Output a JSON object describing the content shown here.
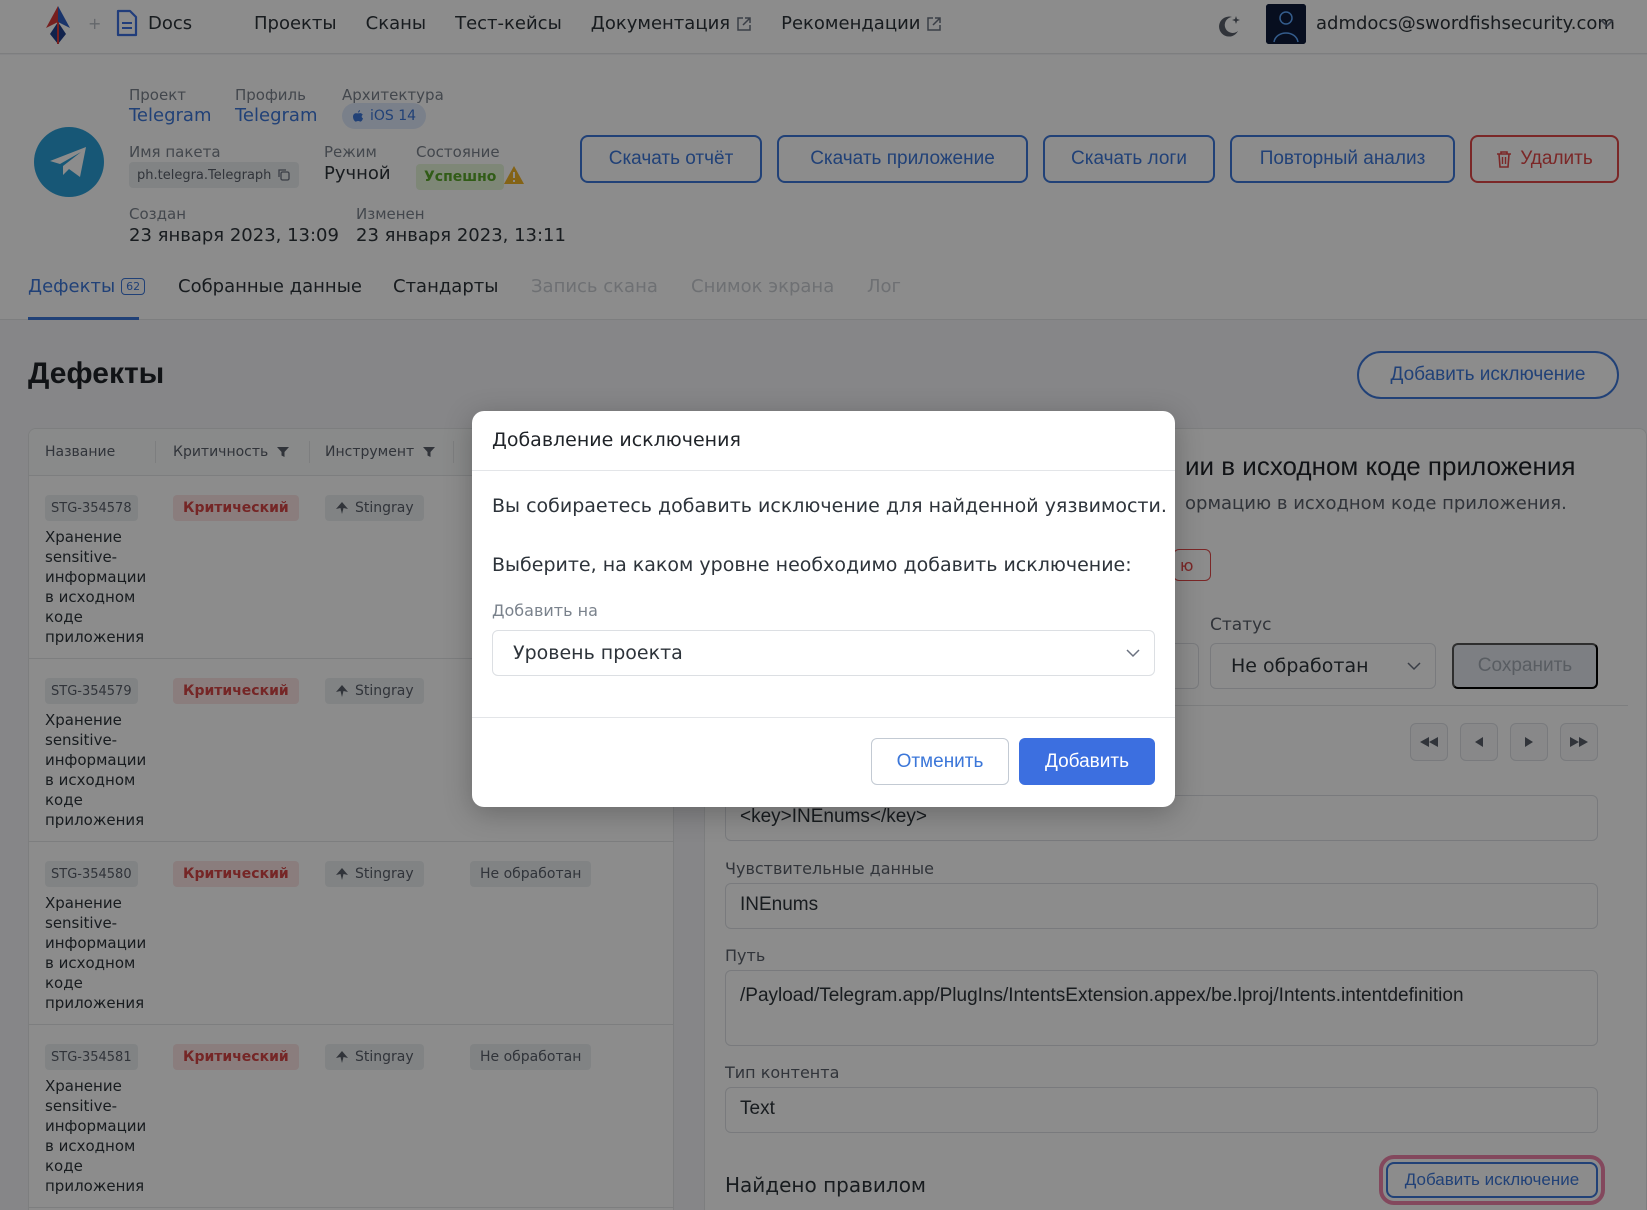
{
  "nav": {
    "docs_label": "Docs",
    "items": [
      "Проекты",
      "Сканы",
      "Тест-кейсы",
      "Документация",
      "Рекомендации"
    ],
    "user_email": "admdocs@swordfishsecurity.com"
  },
  "header": {
    "project_label": "Проект",
    "project_value": "Telegram",
    "profile_label": "Профиль",
    "profile_value": "Telegram",
    "arch_label": "Архитектура",
    "arch_value": "iOS 14",
    "package_label": "Имя пакета",
    "package_value": "ph.telegra.Telegraph",
    "mode_label": "Режим",
    "mode_value": "Ручной",
    "state_label": "Состояние",
    "state_value": "Успешно",
    "created_label": "Создан",
    "created_value": "23 января 2023, 13:09",
    "modified_label": "Изменен",
    "modified_value": "23 января 2023, 13:11",
    "buttons": {
      "download_report": "Скачать отчёт",
      "download_app": "Скачать приложение",
      "download_logs": "Скачать логи",
      "reanalyze": "Повторный анализ",
      "delete": "Удалить"
    }
  },
  "tabs": [
    {
      "label": "Дефекты",
      "badge": "62"
    },
    {
      "label": "Собранные данные"
    },
    {
      "label": "Стандарты"
    },
    {
      "label": "Запись скана"
    },
    {
      "label": "Снимок экрана"
    },
    {
      "label": "Лог"
    }
  ],
  "defects": {
    "title": "Дефекты",
    "add_exception": "Добавить исключение",
    "columns": [
      "Название",
      "Критичность",
      "Инструмент"
    ],
    "rows": [
      {
        "id": "STG-354578",
        "name": "Хранение sensitive-информации в исходном коде приложения",
        "severity": "Критический",
        "tool": "Stingray",
        "status": ""
      },
      {
        "id": "STG-354579",
        "name": "Хранение sensitive-информации в исходном коде приложения",
        "severity": "Критический",
        "tool": "Stingray",
        "status": ""
      },
      {
        "id": "STG-354580",
        "name": "Хранение sensitive-информации в исходном коде приложения",
        "severity": "Критический",
        "tool": "Stingray",
        "status": "Не обработан"
      },
      {
        "id": "STG-354581",
        "name": "Хранение sensitive-информации в исходном коде приложения",
        "severity": "Критический",
        "tool": "Stingray",
        "status": "Не обработан"
      }
    ]
  },
  "detail": {
    "title_partial": "ии в исходном коде приложения",
    "subtitle_partial": "ормацию в исходном коде приложения.",
    "chip_partial": "ю",
    "status_label": "Статус",
    "status_value": "Не обработан",
    "save": "Сохранить",
    "key_value": "<key>INEnums</key>",
    "sensitive_label": "Чувствительные данные",
    "sensitive_value": "INEnums",
    "path_label": "Путь",
    "path_value": "/Payload/Telegram.app/PlugIns/IntentsExtension.appex/be.lproj/Intents.intentdefinition",
    "content_type_label": "Тип контента",
    "content_type_value": "Text",
    "found_by_rule": "Найдено правилом",
    "add_exception": "Добавить исключение"
  },
  "modal": {
    "title": "Добавление исключения",
    "text1": "Вы собираетесь добавить исключение для найденной уязвимости.",
    "text2": "Выберите, на каком уровне необходимо добавить исключение:",
    "select_label": "Добавить на",
    "select_value": "Уровень проекта",
    "cancel": "Отменить",
    "add": "Добавить"
  },
  "colors": {
    "accent": "#3c77d9",
    "danger": "#e04848",
    "primary_button": "#3c6fe0",
    "success": "#5aa82b"
  }
}
